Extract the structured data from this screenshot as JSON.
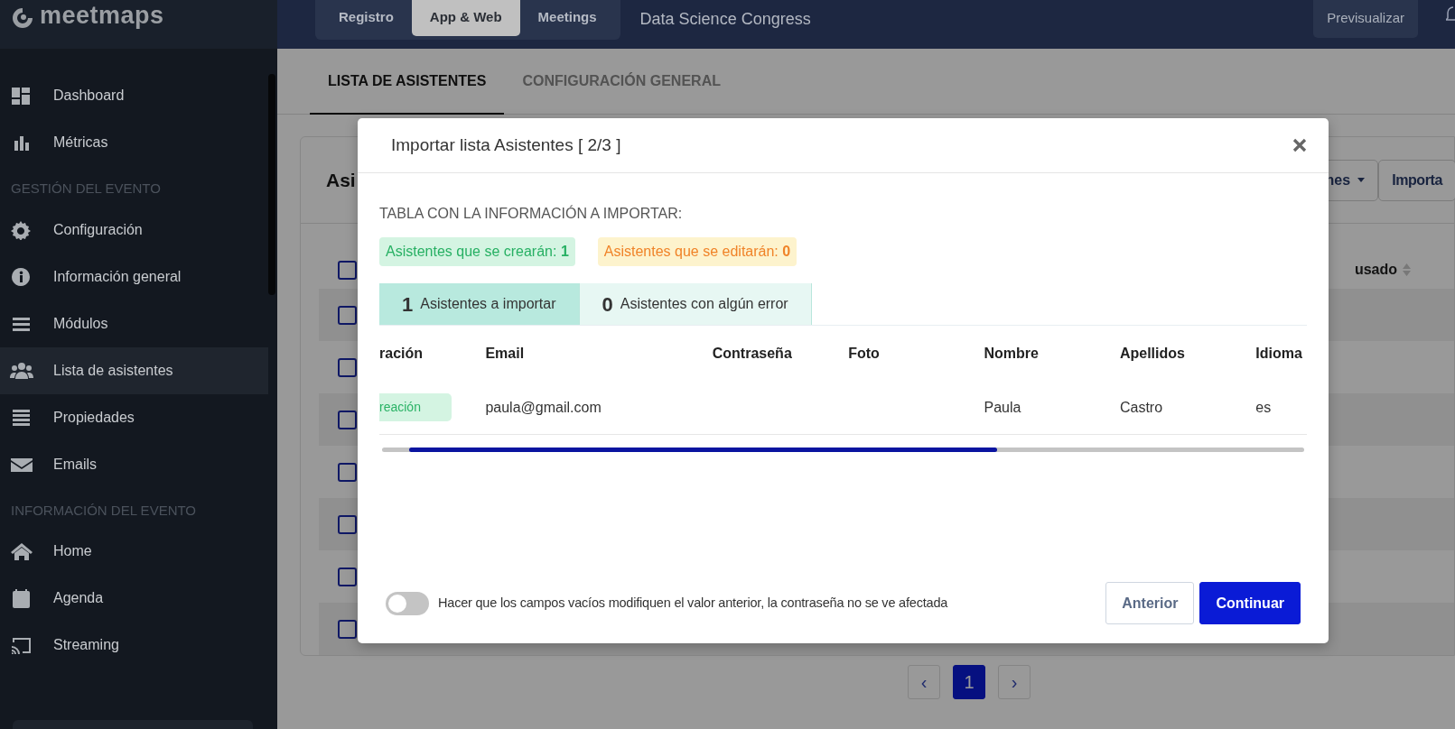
{
  "sidebar": {
    "logo": "meetmaps",
    "sections": [
      {
        "items": [
          {
            "label": "Dashboard",
            "selected": false
          },
          {
            "label": "Métricas",
            "selected": false
          }
        ]
      },
      {
        "heading": "GESTIÓN DEL EVENTO",
        "items": [
          {
            "label": "Configuración",
            "selected": false
          },
          {
            "label": "Información general",
            "selected": false
          },
          {
            "label": "Módulos",
            "selected": false
          },
          {
            "label": "Lista de asistentes",
            "selected": true
          },
          {
            "label": "Propiedades",
            "selected": false
          },
          {
            "label": "Emails",
            "selected": false
          }
        ]
      },
      {
        "heading": "INFORMACIÓN DEL EVENTO",
        "items": [
          {
            "label": "Home",
            "selected": false
          },
          {
            "label": "Agenda",
            "selected": false
          },
          {
            "label": "Streaming",
            "selected": false
          }
        ]
      }
    ]
  },
  "top_bar": {
    "tabs": [
      {
        "label": "Registro",
        "selected": false
      },
      {
        "label": "App & Web",
        "selected": true
      },
      {
        "label": "Meetings",
        "selected": false
      }
    ],
    "event_title": "Data Science Congress",
    "preview_button": "Previsualizar"
  },
  "page_tabs": [
    {
      "label": "LISTA DE ASISTENTES",
      "selected": true
    },
    {
      "label": "CONFIGURACIÓN GENERAL",
      "selected": false
    }
  ],
  "card": {
    "title": "Asi",
    "dropdown_button": "nes",
    "import_button": "Importa",
    "last_column": "usado",
    "header_checkbox": {
      "checked": false
    },
    "rows": [
      {
        "checked": false
      },
      {
        "checked": false
      },
      {
        "checked": false
      },
      {
        "checked": false
      },
      {
        "checked": false
      },
      {
        "checked": false
      },
      {
        "checked": false
      }
    ]
  },
  "pagination": {
    "prev": "‹",
    "next": "›",
    "pages": [
      {
        "label": "1",
        "selected": true
      }
    ]
  },
  "modal": {
    "title": "Importar lista Asistentes [ 2/3 ]",
    "section_label": "TABLA CON LA INFORMACIÓN A IMPORTAR:",
    "summary": [
      {
        "kind": "create",
        "text": "Asistentes que se crearán: ",
        "count": "1"
      },
      {
        "kind": "edit",
        "text": "Asistentes que se editarán: ",
        "count": "0"
      }
    ],
    "tabs": [
      {
        "count": "1",
        "label": "Asistentes a importar",
        "selected": true
      },
      {
        "count": "0",
        "label": "Asistentes con algún error",
        "selected": false
      }
    ],
    "table": {
      "columns": [
        "ración",
        "Email",
        "Contraseña",
        "Foto",
        "Nombre",
        "Apellidos",
        "Idioma"
      ],
      "rows": [
        {
          "cells": [
            "reación",
            "paula@gmail.com",
            null,
            null,
            "Paula",
            "Castro",
            "es"
          ]
        }
      ]
    },
    "toggle": {
      "label": "Hacer que los campos vacíos modifiquen el valor anterior, la contraseña no se ve afectada",
      "on": false
    },
    "buttons": [
      {
        "label": "Anterior",
        "kind": "secondary"
      },
      {
        "label": "Continuar",
        "kind": "primary"
      }
    ]
  }
}
